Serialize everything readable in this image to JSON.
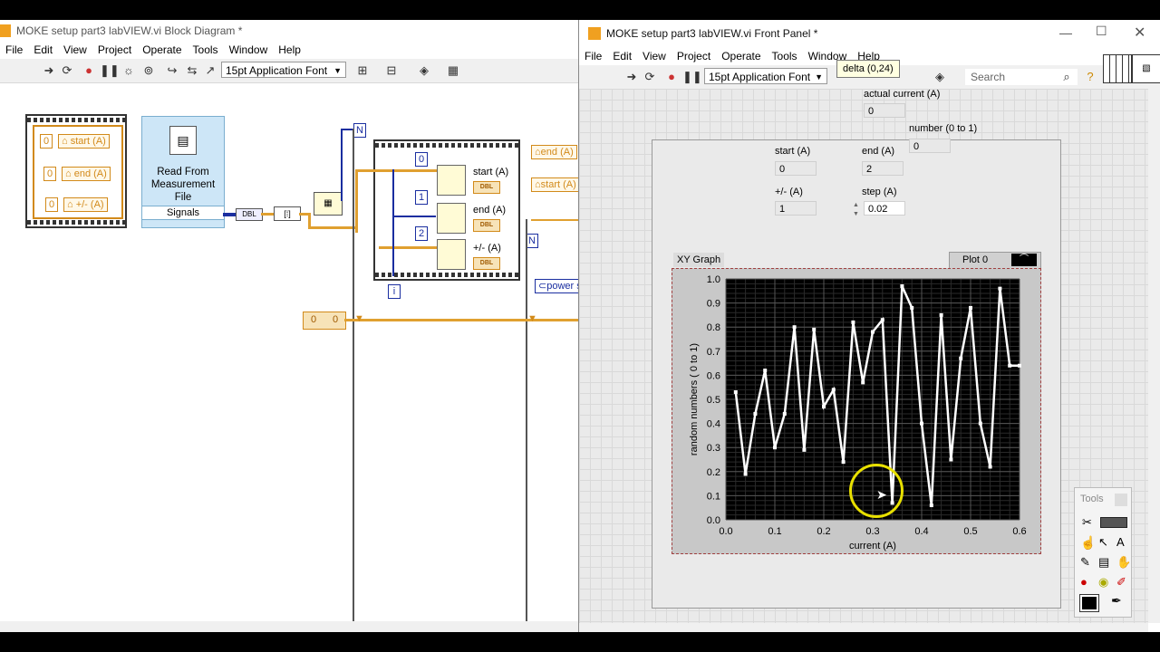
{
  "block_diagram": {
    "title": "MOKE setup part3 labVIEW.vi Block Diagram *",
    "menu": [
      "File",
      "Edit",
      "View",
      "Project",
      "Operate",
      "Tools",
      "Window",
      "Help"
    ],
    "font_selector": "15pt Application Font",
    "cluster_items": [
      {
        "value": "0",
        "label": "start (A)"
      },
      {
        "value": "0",
        "label": "end (A)"
      },
      {
        "value": "0",
        "label": "+/- (A)"
      }
    ],
    "read_file_label": "Read From Measurement File",
    "signals_label": "Signals",
    "loop_constants": [
      "0",
      "1",
      "2"
    ],
    "loop_outputs": [
      "start (A)",
      "end (A)",
      "+/- (A)"
    ],
    "dbl_label": "DBL",
    "n_label": "N",
    "i_label": "i",
    "right_terms": [
      "end (A)",
      "start (A)"
    ],
    "power_term": "power s",
    "shift_const": [
      "0",
      "0"
    ]
  },
  "front_panel": {
    "title": "MOKE setup part3 labVIEW.vi Front Panel *",
    "menu": [
      "File",
      "Edit",
      "View",
      "Project",
      "Operate",
      "Tools",
      "Window",
      "Help"
    ],
    "font_selector": "15pt Application Font",
    "tooltip": "delta (0,24)",
    "search_placeholder": "Search",
    "actual_current_label": "actual current (A)",
    "actual_current_value": "0",
    "number_label": "number (0 to 1)",
    "number_value": "0",
    "start_label": "start (A)",
    "start_value": "0",
    "end_label": "end (A)",
    "end_value": "2",
    "pm_label": "+/- (A)",
    "pm_value": "1",
    "step_label": "step (A)",
    "step_value": "0.02",
    "graph_label": "XY Graph",
    "plot_legend": "Plot 0",
    "tools_palette_title": "Tools"
  },
  "colors": {
    "plot_bg": "#000000",
    "plot_line": "#ffffff",
    "cursor_ring": "#e8e000",
    "wire_orange": "#e0a030",
    "wire_blue": "#1a2ea0"
  },
  "chart_data": {
    "type": "line",
    "title": "",
    "xlabel": "current (A)",
    "ylabel": "random numbers ( 0 to 1)",
    "xlim": [
      0,
      0.6
    ],
    "ylim": [
      0,
      1.0
    ],
    "x_ticks": [
      "0.0",
      "0.1",
      "0.2",
      "0.3",
      "0.4",
      "0.5",
      "0.6"
    ],
    "y_ticks": [
      "0.0",
      "0.1",
      "0.2",
      "0.3",
      "0.4",
      "0.5",
      "0.6",
      "0.7",
      "0.8",
      "0.9",
      "1.0"
    ],
    "grid": true,
    "series": [
      {
        "name": "Plot 0",
        "x": [
          0.02,
          0.04,
          0.06,
          0.08,
          0.1,
          0.12,
          0.14,
          0.16,
          0.18,
          0.2,
          0.22,
          0.24,
          0.26,
          0.28,
          0.3,
          0.32,
          0.34,
          0.36,
          0.38,
          0.4,
          0.42,
          0.44,
          0.46,
          0.48,
          0.5,
          0.52,
          0.54,
          0.56,
          0.58,
          0.6
        ],
        "y": [
          0.53,
          0.19,
          0.44,
          0.62,
          0.3,
          0.44,
          0.8,
          0.29,
          0.79,
          0.47,
          0.54,
          0.24,
          0.82,
          0.57,
          0.78,
          0.83,
          0.07,
          0.97,
          0.88,
          0.4,
          0.06,
          0.85,
          0.25,
          0.67,
          0.88,
          0.4,
          0.22,
          0.96,
          0.64,
          0.64
        ]
      }
    ]
  }
}
